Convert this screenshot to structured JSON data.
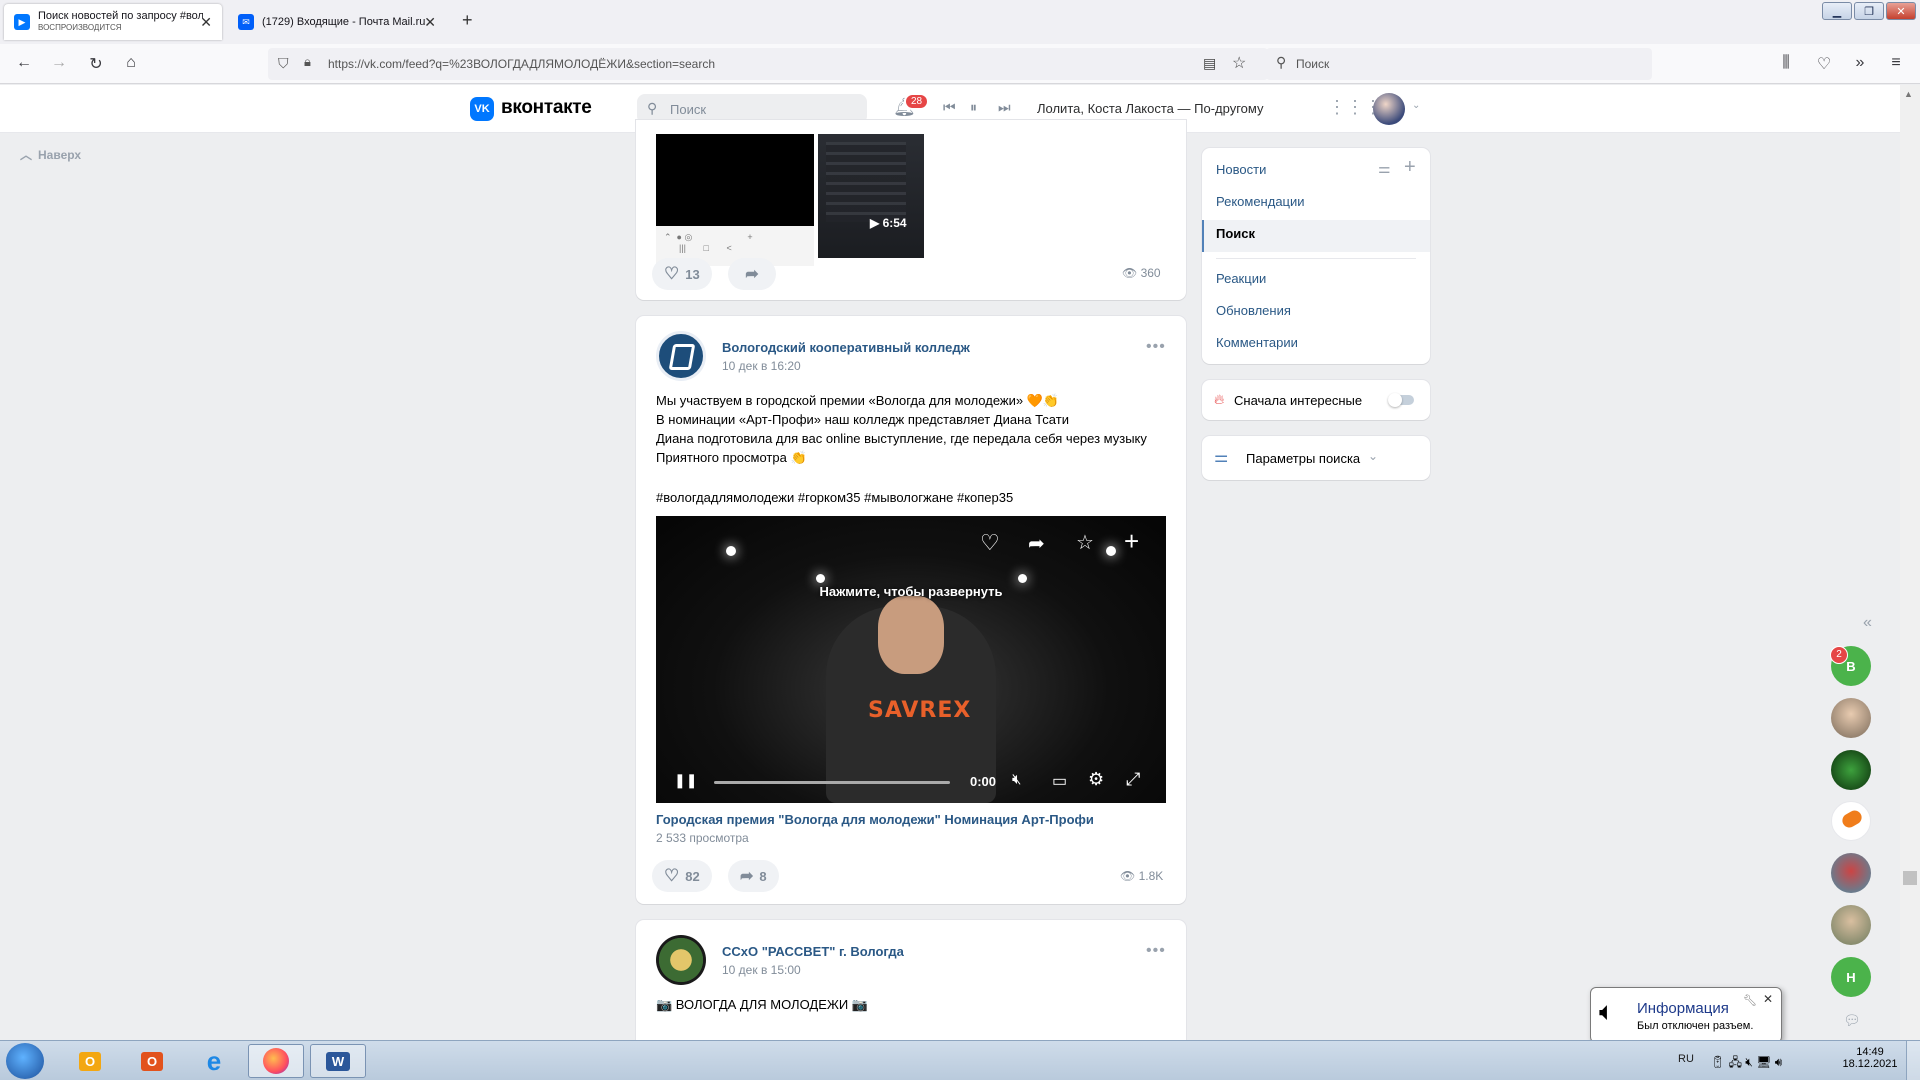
{
  "browser": {
    "tabs": [
      {
        "title": "Поиск новостей по запросу #волог...",
        "subtitle": "ВОСПРОИЗВОДИТСЯ",
        "close": "✕"
      },
      {
        "title": "(1729) Входящие - Почта Mail.ru",
        "close": "✕"
      }
    ],
    "new_tab": "+",
    "url": "https://vk.com/feed?q=%23ВОЛОГДАДЛЯМОЛОДЁЖИ&section=search",
    "search_placeholder": "Поиск"
  },
  "vk": {
    "logo_text": "вконтакте",
    "search_placeholder": "Поиск",
    "notifications_count": "28",
    "now_playing": "Лолита, Коста Лакоста — По-другому",
    "back_to_top": "Наверх"
  },
  "post0": {
    "video_duration": "6:54",
    "likes": "13",
    "views": "360"
  },
  "post1": {
    "author": "Вологодский кооперативный колледж",
    "date": "10 дек в 16:20",
    "lines": [
      "Мы участвуем в городской премии «Вологда для молодежи» 🧡👏",
      "В номинации «Арт-Профи» наш колледж представляет Диана Тсати",
      "Диана подготовила для вас online выступление, где передала себя через музыку",
      "Приятного просмотра 👏"
    ],
    "hashtags": "#вологдадлямолодежи #горком35 #мывологжане #копер35",
    "video_hint": "Нажмите, чтобы развернуть",
    "video_time": "0:00",
    "video_title": "Городская премия \"Вологда для молодежи\" Номинация Арт-Профи",
    "video_views": "2 533 просмотра",
    "likes": "82",
    "shares": "8",
    "views": "1.8K"
  },
  "post2": {
    "author": "ССхО \"РАССВЕТ\" г. Вологда",
    "date": "10 дек в 15:00",
    "text": "📷 ВОЛОГДА ДЛЯ МОЛОДЕЖИ 📷"
  },
  "right_menu": {
    "items": [
      "Новости",
      "Рекомендации",
      "Поиск",
      "Реакции",
      "Обновления",
      "Комментарии"
    ],
    "interesting_first": "Сначала интересные",
    "search_params": "Параметры поиска"
  },
  "chats": {
    "badge": "2",
    "b_letter": "В",
    "h_letter": "Н"
  },
  "notification": {
    "title": "Информация",
    "text": "Был отключен разъем."
  },
  "taskbar": {
    "lang": "RU",
    "time": "14:49",
    "date": "18.12.2021"
  },
  "colors": {
    "vk_blue": "#0077ff",
    "link": "#2a5885",
    "accent_green": "#4bb34b"
  }
}
